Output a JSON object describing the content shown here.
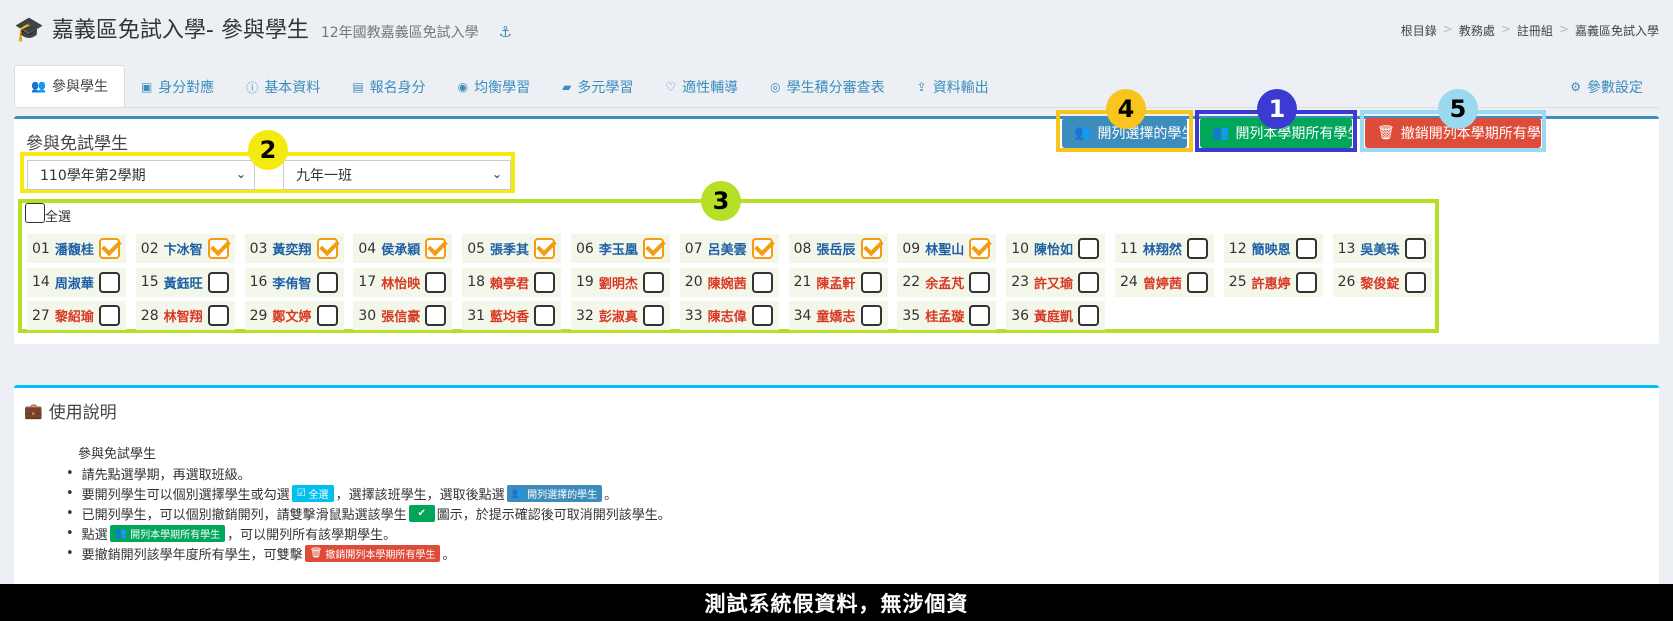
{
  "header": {
    "title": "嘉義區免試入學- 參與學生",
    "subtitle": "12年國教嘉義區免試入學",
    "breadcrumb": [
      "根目錄",
      "教務處",
      "註冊組",
      "嘉義區免試入學"
    ]
  },
  "tabs": [
    {
      "label": "參與學生",
      "icon": "users-icon"
    },
    {
      "label": "身分對應",
      "icon": "id-card-icon"
    },
    {
      "label": "基本資料",
      "icon": "info-icon"
    },
    {
      "label": "報名身分",
      "icon": "vcard-icon"
    },
    {
      "label": "均衡學習",
      "icon": "compass-icon"
    },
    {
      "label": "多元學習",
      "icon": "book-icon"
    },
    {
      "label": "適性輔導",
      "icon": "heart-icon"
    },
    {
      "label": "學生積分審查表",
      "icon": "eye-icon"
    },
    {
      "label": "資料輸出",
      "icon": "upload-icon"
    }
  ],
  "settings_label": "參數設定",
  "panel": {
    "title": "參與免試學生",
    "btn_selected": "開列選擇的學生",
    "btn_all": "開列本學期所有學生",
    "btn_revoke": "撤銷開列本學期所有學生",
    "semester": "110學年第2學期",
    "class": "九年一班",
    "select_all": "全選"
  },
  "badges": [
    "1",
    "2",
    "3",
    "4",
    "5"
  ],
  "colors": {
    "primary": "#3c8dbc",
    "success": "#00a65a",
    "danger": "#dd4b39",
    "warning": "#f39c12"
  },
  "students": [
    {
      "no": "01",
      "name": "潘馥桂",
      "g": "m",
      "checked": true
    },
    {
      "no": "02",
      "name": "卞冰智",
      "g": "m",
      "checked": true
    },
    {
      "no": "03",
      "name": "黃奕翔",
      "g": "m",
      "checked": true
    },
    {
      "no": "04",
      "name": "侯承穎",
      "g": "m",
      "checked": true
    },
    {
      "no": "05",
      "name": "張季其",
      "g": "m",
      "checked": true
    },
    {
      "no": "06",
      "name": "李玉凰",
      "g": "m",
      "checked": true
    },
    {
      "no": "07",
      "name": "呂美雲",
      "g": "m",
      "checked": true
    },
    {
      "no": "08",
      "name": "張岳辰",
      "g": "m",
      "checked": true
    },
    {
      "no": "09",
      "name": "林聖山",
      "g": "m",
      "checked": true
    },
    {
      "no": "10",
      "name": "陳怡如",
      "g": "m",
      "checked": false
    },
    {
      "no": "11",
      "name": "林翔然",
      "g": "m",
      "checked": false
    },
    {
      "no": "12",
      "name": "簡映恩",
      "g": "m",
      "checked": false
    },
    {
      "no": "13",
      "name": "吳美珠",
      "g": "m",
      "checked": false
    },
    {
      "no": "14",
      "name": "周淑華",
      "g": "m",
      "checked": false
    },
    {
      "no": "15",
      "name": "黃鈺旺",
      "g": "m",
      "checked": false
    },
    {
      "no": "16",
      "name": "李侑智",
      "g": "m",
      "checked": false
    },
    {
      "no": "17",
      "name": "林怡映",
      "g": "f",
      "checked": false
    },
    {
      "no": "18",
      "name": "賴亭君",
      "g": "f",
      "checked": false
    },
    {
      "no": "19",
      "name": "劉明杰",
      "g": "f",
      "checked": false
    },
    {
      "no": "20",
      "name": "陳婉茜",
      "g": "f",
      "checked": false
    },
    {
      "no": "21",
      "name": "陳孟軒",
      "g": "f",
      "checked": false
    },
    {
      "no": "22",
      "name": "余孟芃",
      "g": "f",
      "checked": false
    },
    {
      "no": "23",
      "name": "許又瑜",
      "g": "f",
      "checked": false
    },
    {
      "no": "24",
      "name": "曾婷茜",
      "g": "f",
      "checked": false
    },
    {
      "no": "25",
      "name": "許惠婷",
      "g": "f",
      "checked": false
    },
    {
      "no": "26",
      "name": "黎俊錠",
      "g": "f",
      "checked": false
    },
    {
      "no": "27",
      "name": "黎紹瑜",
      "g": "f",
      "checked": false
    },
    {
      "no": "28",
      "name": "林智翔",
      "g": "f",
      "checked": false
    },
    {
      "no": "29",
      "name": "鄭文婷",
      "g": "f",
      "checked": false
    },
    {
      "no": "30",
      "name": "張信豪",
      "g": "f",
      "checked": false
    },
    {
      "no": "31",
      "name": "藍均香",
      "g": "f",
      "checked": false
    },
    {
      "no": "32",
      "name": "彭淑真",
      "g": "f",
      "checked": false
    },
    {
      "no": "33",
      "name": "陳志偉",
      "g": "f",
      "checked": false
    },
    {
      "no": "34",
      "name": "童嬌志",
      "g": "f",
      "checked": false
    },
    {
      "no": "35",
      "name": "桂孟璇",
      "g": "f",
      "checked": false
    },
    {
      "no": "36",
      "name": "黃庭凱",
      "g": "f",
      "checked": false
    }
  ],
  "usage": {
    "title": "使用說明",
    "heading": "參與免試學生",
    "l1": "請先點選學期，再選取班級。",
    "l2a": "要開列學生可以個別選擇學生或勾選",
    "l2_badge1": "全選",
    "l2b": "，選擇該班學生，選取後點選",
    "l2_badge2": "開列選擇的學生",
    "l2c": "。",
    "l3a": "已開列學生，可以個別撤銷開列，請雙擊滑鼠點選該學生",
    "l3b": "圖示，於提示確認後可取消開列該學生。",
    "l4a": "點選",
    "l4_badge": "開列本學期所有學生",
    "l4b": "，可以開列所有該學期學生。",
    "l5a": "要撤銷開列該學年度所有學生，可雙擊",
    "l5_badge": "撤銷開列本學期所有學生",
    "l5b": "。"
  },
  "footer": "測試系統假資料，無涉個資"
}
